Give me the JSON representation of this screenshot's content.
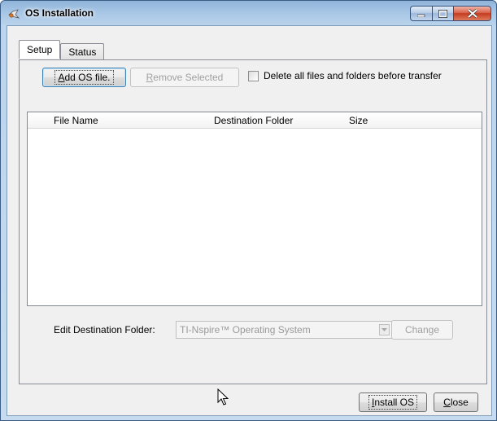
{
  "window": {
    "title": "OS Installation"
  },
  "tabs": [
    {
      "label": "Setup",
      "active": true
    },
    {
      "label": "Status",
      "active": false
    }
  ],
  "toolbar": {
    "add_os_file": {
      "prefix": "",
      "mnemonic": "A",
      "rest": "dd OS file."
    },
    "remove_selected": {
      "prefix": "",
      "mnemonic": "R",
      "rest": "emove Selected"
    },
    "delete_all_label": "Delete all files and folders before transfer",
    "delete_all_checked": false
  },
  "file_table": {
    "columns": [
      "File Name",
      "Destination Folder",
      "Size"
    ],
    "rows": []
  },
  "destination": {
    "label": "Edit Destination Folder:",
    "selected": "TI-Nspire™ Operating System",
    "change_label": "Change"
  },
  "footer": {
    "install_os": {
      "mnemonic": "I",
      "rest": "nstall OS"
    },
    "close": {
      "mnemonic": "C",
      "rest": "lose"
    }
  },
  "colors": {
    "title_bar": "#a9c7e6",
    "close_button": "#c43c1f",
    "client_bg": "#f0f0f0",
    "disabled_text": "#a0a0a0"
  },
  "icons": {
    "app": "ti-app-icon",
    "minimize": "minimize-icon",
    "maximize": "maximize-icon",
    "close": "close-icon",
    "dropdown": "chevron-down-icon",
    "cursor": "mouse-pointer-icon"
  }
}
